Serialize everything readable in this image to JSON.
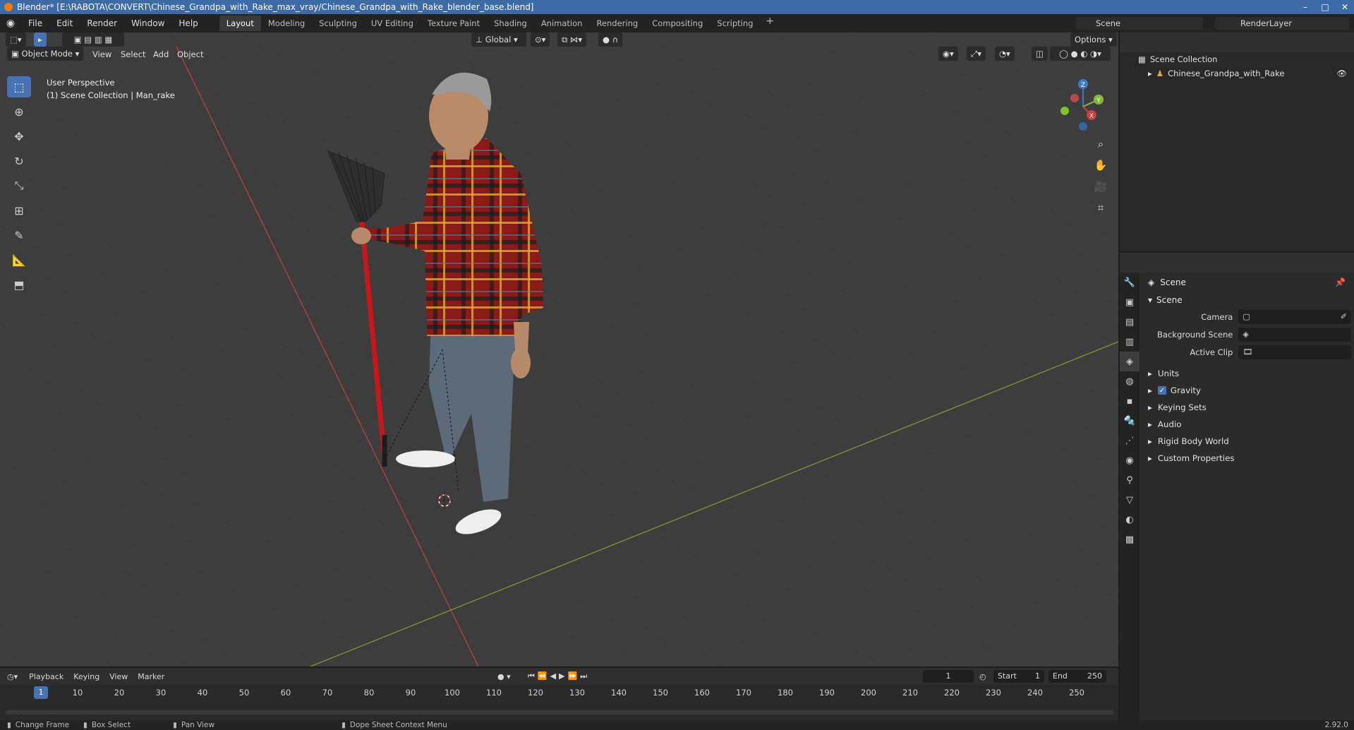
{
  "window": {
    "title": "Blender* [E:\\RABOTA\\CONVERT\\Chinese_Grandpa_with_Rake_max_vray/Chinese_Grandpa_with_Rake_blender_base.blend]",
    "min": "–",
    "max": "□",
    "close": "✕"
  },
  "menu": [
    "File",
    "Edit",
    "Render",
    "Window",
    "Help"
  ],
  "workspaces": [
    "Layout",
    "Modeling",
    "Sculpting",
    "UV Editing",
    "Texture Paint",
    "Shading",
    "Animation",
    "Rendering",
    "Compositing",
    "Scripting"
  ],
  "active_workspace": "Layout",
  "scene_name": "Scene",
  "render_layer": "RenderLayer",
  "viewport": {
    "mode": "Object Mode",
    "menus": [
      "View",
      "Select",
      "Add",
      "Object"
    ],
    "orientation": "Global",
    "options": "Options",
    "perspective": "User Perspective",
    "collection_info": "(1) Scene Collection | Man_rake",
    "axes": {
      "x": "X",
      "y": "Y",
      "z": "Z"
    }
  },
  "outliner": {
    "root": "Scene Collection",
    "items": [
      "Chinese_Grandpa_with_Rake"
    ]
  },
  "properties": {
    "title": "Scene",
    "panel": "Scene",
    "rows": [
      {
        "label": "Camera"
      },
      {
        "label": "Background Scene"
      },
      {
        "label": "Active Clip"
      }
    ],
    "subpanels": [
      "Units",
      "Gravity",
      "Keying Sets",
      "Audio",
      "Rigid Body World",
      "Custom Properties"
    ]
  },
  "timeline": {
    "menus": [
      "Playback",
      "Keying",
      "View",
      "Marker"
    ],
    "current_frame": "1",
    "start_label": "Start",
    "start": "1",
    "end_label": "End",
    "end": "250",
    "ticks": [
      "10",
      "20",
      "30",
      "40",
      "50",
      "60",
      "70",
      "80",
      "90",
      "100",
      "110",
      "120",
      "130",
      "140",
      "150",
      "160",
      "170",
      "180",
      "190",
      "200",
      "210",
      "220",
      "230",
      "240",
      "250"
    ],
    "playhead": "1"
  },
  "statusbar": {
    "items": [
      "Change Frame",
      "Box Select",
      "Pan View",
      "Dope Sheet Context Menu"
    ],
    "version": "2.92.0"
  },
  "colors": {
    "accent": "#4772b3",
    "x_axis": "#c9403c",
    "y_axis": "#8ab83a",
    "z_axis": "#3f7ac8"
  }
}
